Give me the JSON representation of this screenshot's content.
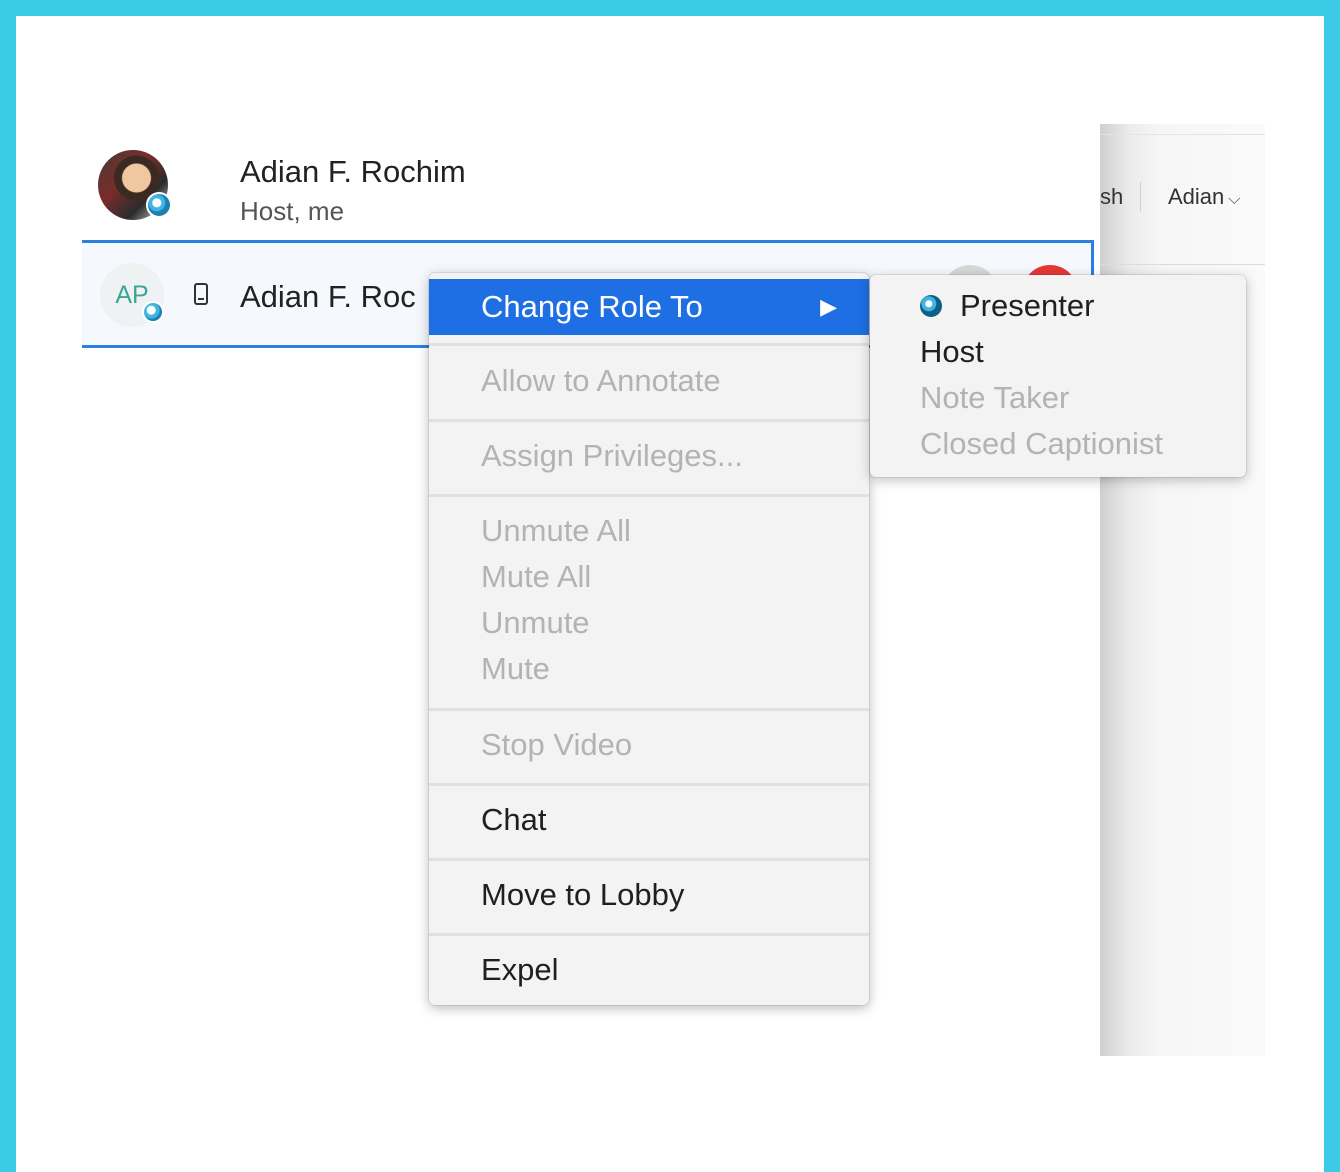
{
  "header": {
    "partial_text": "sh",
    "user_menu": "Adian",
    "user_menu_icon": "chevron-down-icon"
  },
  "participants": [
    {
      "name": "Adian F. Rochim",
      "role": "Host, me"
    },
    {
      "initials": "AP",
      "name": "Adian F. Roc"
    }
  ],
  "context_menu": {
    "change_role": "Change Role To",
    "allow_annotate": "Allow to Annotate",
    "assign_privileges": "Assign Privileges...",
    "unmute_all": "Unmute All",
    "mute_all": "Mute All",
    "unmute": "Unmute",
    "mute": "Mute",
    "stop_video": "Stop Video",
    "chat": "Chat",
    "move_to_lobby": "Move to Lobby",
    "expel": "Expel"
  },
  "submenu": {
    "presenter": "Presenter",
    "host": "Host",
    "note_taker": "Note Taker",
    "closed_captionist": "Closed Captionist"
  },
  "colors": {
    "frame": "#3ccbe6",
    "highlight": "#1e6fe3",
    "selection_border": "#2a7fe0",
    "disabled_text": "#b3b3b3",
    "initials_text": "#3aa69a"
  }
}
